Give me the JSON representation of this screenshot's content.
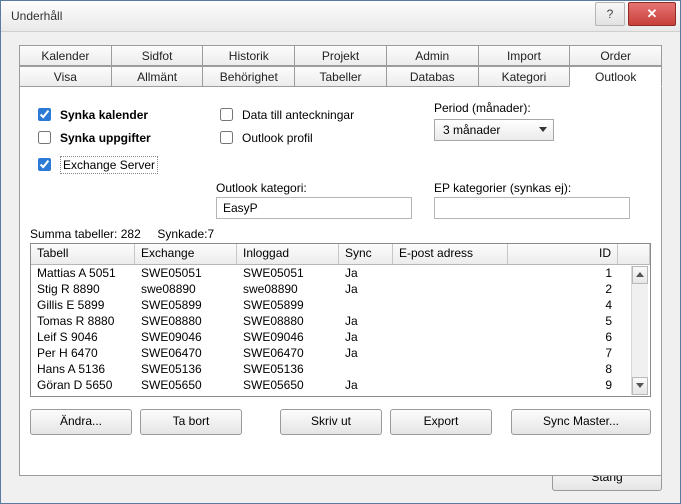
{
  "window": {
    "title": "Underhåll",
    "help": "?",
    "close": "✕"
  },
  "tabs_row1": {
    "t0": "Kalender",
    "t1": "Sidfot",
    "t2": "Historik",
    "t3": "Projekt",
    "t4": "Admin",
    "t5": "Import",
    "t6": "Order"
  },
  "tabs_row2": {
    "t0": "Visa",
    "t1": "Allmänt",
    "t2": "Behörighet",
    "t3": "Tabeller",
    "t4": "Databas",
    "t5": "Kategori",
    "t6": "Outlook"
  },
  "checks": {
    "synka_kalender": "Synka kalender",
    "synka_uppgifter": "Synka uppgifter",
    "data_anteck": "Data till anteckningar",
    "outlook_profil": "Outlook profil",
    "exchange_server": "Exchange Server"
  },
  "period": {
    "label": "Period (månader):",
    "value": "3 månader"
  },
  "outlook_cat": {
    "label": "Outlook kategori:",
    "value": "EasyP"
  },
  "ep_cat": {
    "label": "EP kategorier (synkas ej):",
    "value": ""
  },
  "summary": {
    "tab_label": "Summa tabeller:",
    "tab_value": "282",
    "sync_label": "Synkade:",
    "sync_value": "7"
  },
  "grid": {
    "headers": {
      "h0": "Tabell",
      "h1": "Exchange",
      "h2": "Inloggad",
      "h3": "Sync",
      "h4": "E-post adress",
      "h5": "ID"
    },
    "rows": [
      {
        "c0": "Mattias A 5051",
        "c1": "SWE05051",
        "c2": "SWE05051",
        "c3": "Ja",
        "c4": "",
        "c5": "1"
      },
      {
        "c0": "Stig R 8890",
        "c1": "swe08890",
        "c2": "swe08890",
        "c3": "Ja",
        "c4": "",
        "c5": "2"
      },
      {
        "c0": "Gillis E 5899",
        "c1": "SWE05899",
        "c2": "SWE05899",
        "c3": "",
        "c4": "",
        "c5": "4"
      },
      {
        "c0": "Tomas R 8880",
        "c1": "SWE08880",
        "c2": "SWE08880",
        "c3": "Ja",
        "c4": "",
        "c5": "5"
      },
      {
        "c0": "Leif S 9046",
        "c1": "SWE09046",
        "c2": "SWE09046",
        "c3": "Ja",
        "c4": "",
        "c5": "6"
      },
      {
        "c0": "Per H 6470",
        "c1": "SWE06470",
        "c2": "SWE06470",
        "c3": "Ja",
        "c4": "",
        "c5": "7"
      },
      {
        "c0": "Hans A 5136",
        "c1": "SWE05136",
        "c2": "SWE05136",
        "c3": "",
        "c4": "",
        "c5": "8"
      },
      {
        "c0": "Göran D 5650",
        "c1": "SWE05650",
        "c2": "SWE05650",
        "c3": "Ja",
        "c4": "",
        "c5": "9"
      }
    ]
  },
  "buttons": {
    "andra": "Ändra...",
    "tabort": "Ta bort",
    "skrivut": "Skriv ut",
    "export": "Export",
    "syncmaster": "Sync Master...",
    "stang": "Stäng"
  }
}
